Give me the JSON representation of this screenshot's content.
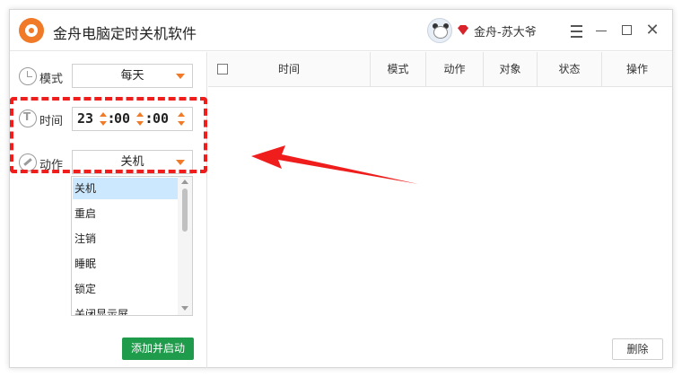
{
  "window": {
    "title": "金舟电脑定时关机软件"
  },
  "user": {
    "name": "金舟-苏大爷"
  },
  "controls": {
    "mode_label": "模式",
    "mode_value": "每天",
    "time_label": "时间",
    "time_hour": "23",
    "time_minute": "00",
    "time_second": "00",
    "action_label": "动作",
    "action_value": "关机"
  },
  "dropdown": {
    "options": [
      "关机",
      "重启",
      "注销",
      "睡眠",
      "锁定",
      "关闭显示屏"
    ],
    "selected_index": 0
  },
  "buttons": {
    "add": "添加并启动",
    "delete": "删除"
  },
  "table": {
    "columns": [
      "时间",
      "模式",
      "动作",
      "对象",
      "状态",
      "操作"
    ],
    "rows": []
  },
  "colors": {
    "accent": "#f07a28",
    "primary_button": "#1e9c4b",
    "annotation": "#f01d1d",
    "selected_option": "#cce8ff"
  },
  "icons": [
    "app-logo-icon",
    "avatar-icon",
    "vip-diamond-icon",
    "menu-icon",
    "minimize-icon",
    "maximize-icon",
    "close-icon",
    "alarm-clock-icon",
    "time-icon",
    "wrench-icon",
    "caret-down-icon"
  ]
}
